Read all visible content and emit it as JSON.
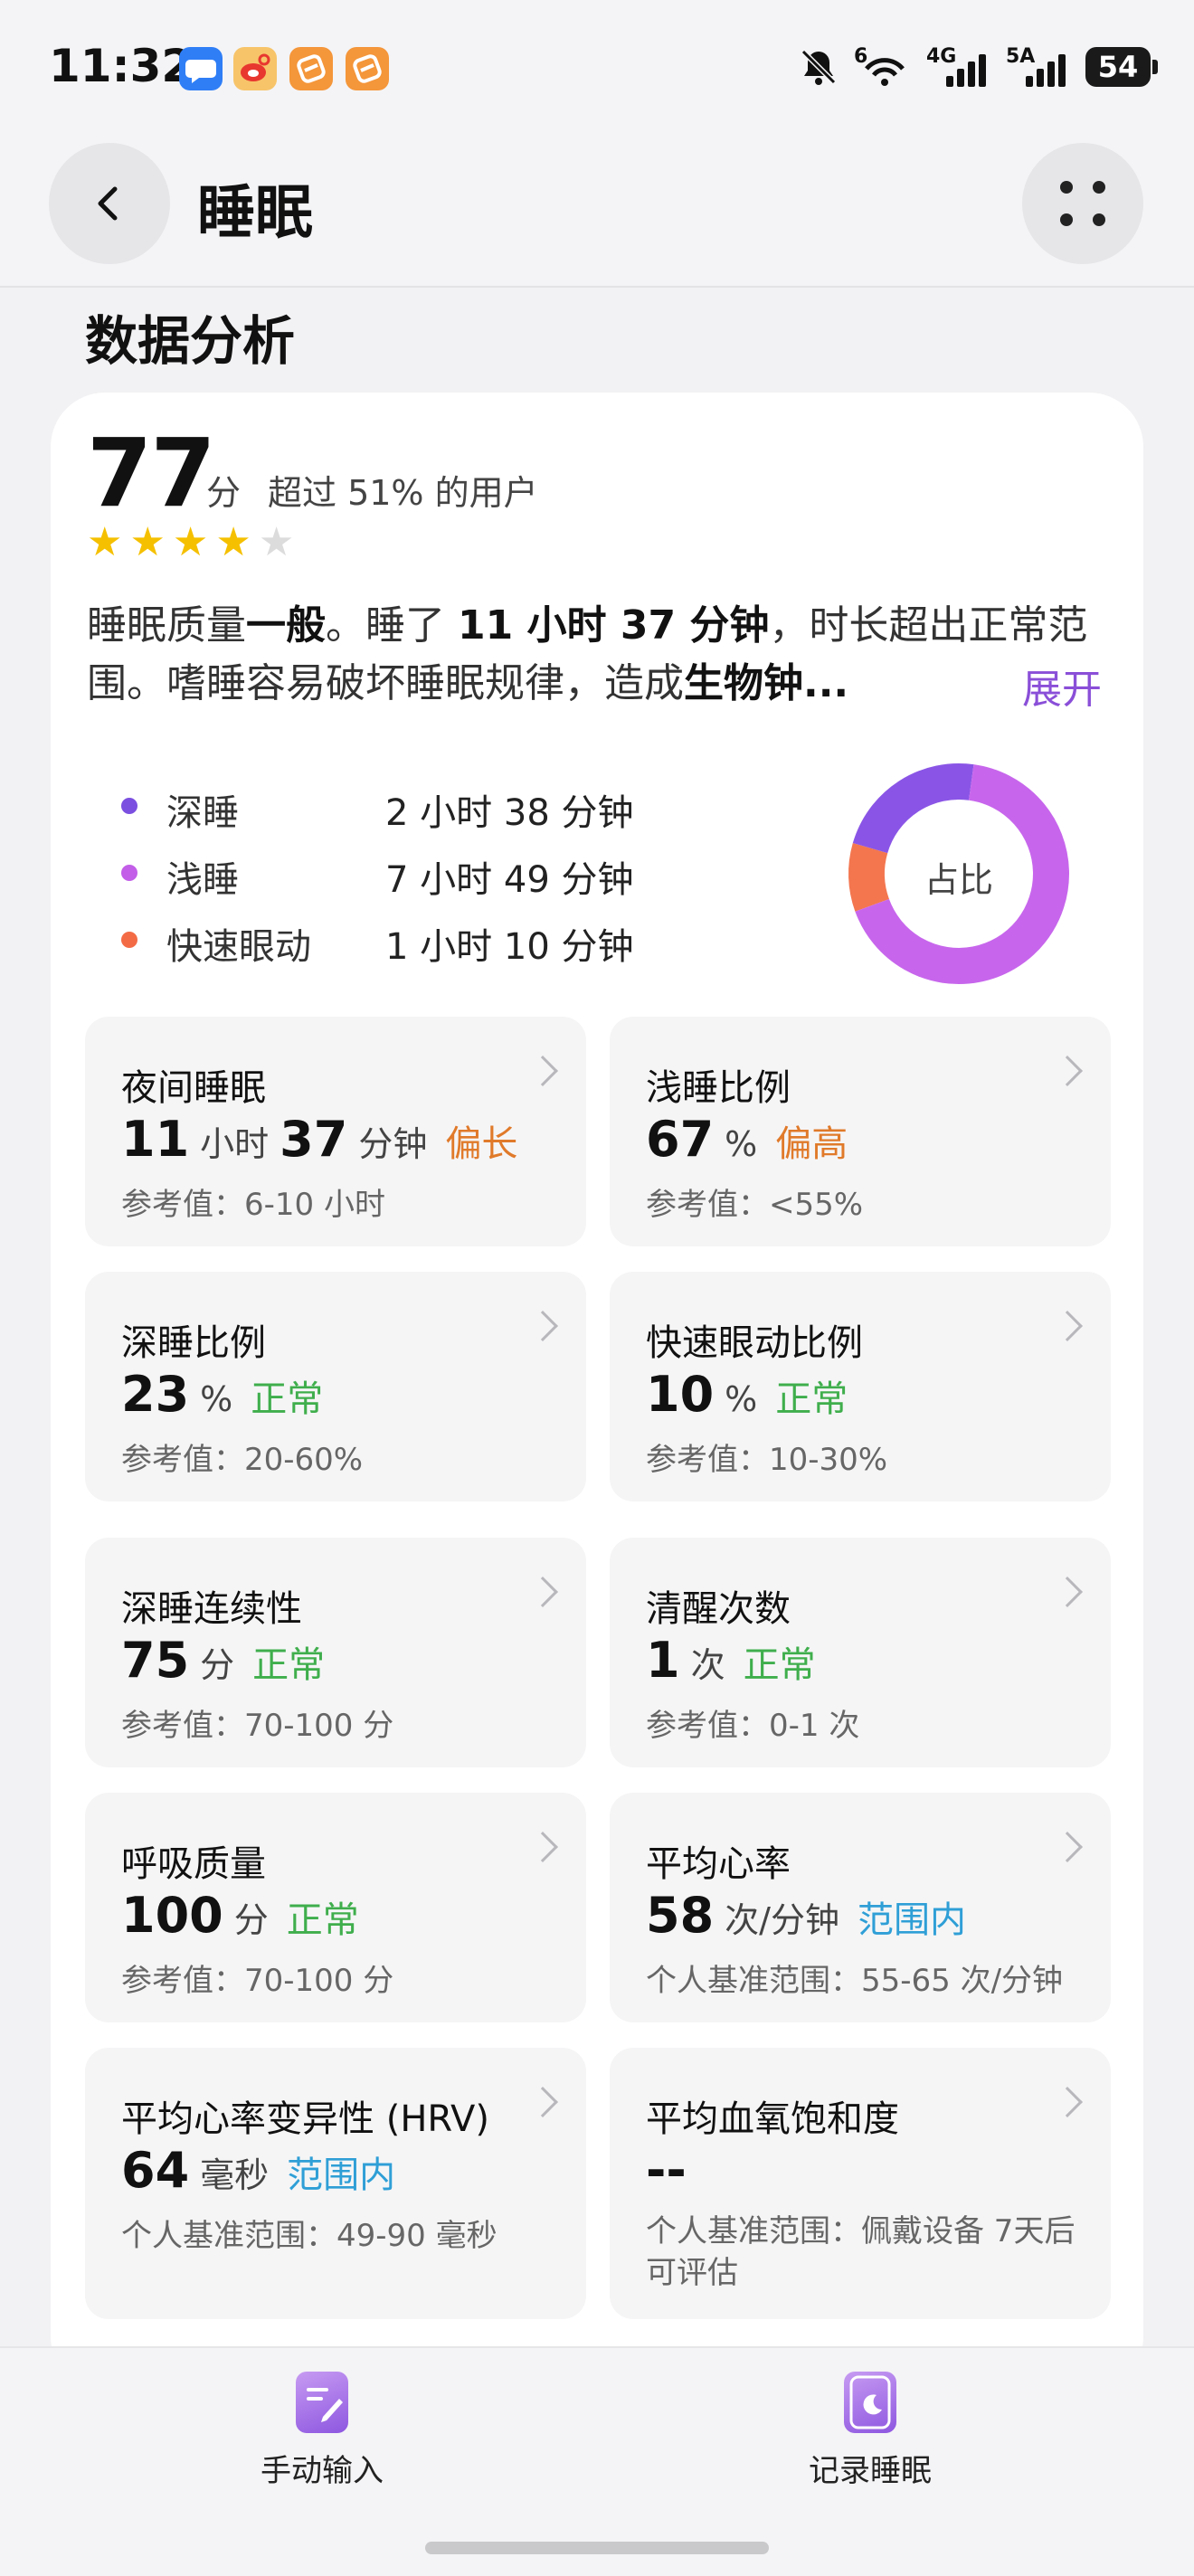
{
  "status_bar": {
    "time": "11:32",
    "signal1_label": "6",
    "signal2_label": "4G",
    "signal3_label": "5A",
    "battery": "54"
  },
  "header": {
    "title": "睡眠"
  },
  "section": {
    "title": "数据分析"
  },
  "score": {
    "value": "77",
    "unit": "分",
    "note": "超过 51% 的用户",
    "stars": 4,
    "max_stars": 5
  },
  "summary": {
    "p1": "睡眠质量",
    "b1": "一般",
    "p2": "。睡了 ",
    "b2": "11 小时 37 分钟",
    "p3": "，时长超出正常范围。嗜睡容易破坏睡眠规律，造成",
    "b3": "生物钟...",
    "expand_label": "展开"
  },
  "legend": [
    {
      "name": "深睡",
      "value": "2 小时 38 分钟",
      "color": "#7b4fe0"
    },
    {
      "name": "浅睡",
      "value": "7 小时 49 分钟",
      "color": "#c25ee8"
    },
    {
      "name": "快速眼动",
      "value": "1 小时 10 分钟",
      "color": "#f36b45"
    }
  ],
  "donut": {
    "label": "占比",
    "segments": [
      {
        "name": "深睡",
        "minutes": 158,
        "color": "#8a55e6"
      },
      {
        "name": "浅睡",
        "minutes": 469,
        "color": "#c766ec"
      },
      {
        "name": "快速眼动",
        "minutes": 70,
        "color": "#f3764f"
      }
    ]
  },
  "metrics": [
    {
      "title": "夜间睡眠",
      "num1": "11",
      "unit1": "小时",
      "num2": "37",
      "unit2": "分钟",
      "status": "偏长",
      "status_color": "#e07a2a",
      "ref": "参考值：6-10 小时"
    },
    {
      "title": "浅睡比例",
      "num1": "67",
      "unit1": "%",
      "status": "偏高",
      "status_color": "#e07a2a",
      "ref": "参考值：<55%"
    },
    {
      "title": "深睡比例",
      "num1": "23",
      "unit1": "%",
      "status": "正常",
      "status_color": "#3fae4c",
      "ref": "参考值：20-60%"
    },
    {
      "title": "快速眼动比例",
      "num1": "10",
      "unit1": "%",
      "status": "正常",
      "status_color": "#3fae4c",
      "ref": "参考值：10-30%"
    },
    {
      "title": "深睡连续性",
      "num1": "75",
      "unit1": "分",
      "status": "正常",
      "status_color": "#3fae4c",
      "ref": "参考值：70-100 分"
    },
    {
      "title": "清醒次数",
      "num1": "1",
      "unit1": "次",
      "status": "正常",
      "status_color": "#3fae4c",
      "ref": "参考值：0-1 次"
    },
    {
      "title": "呼吸质量",
      "num1": "100",
      "unit1": "分",
      "status": "正常",
      "status_color": "#3fae4c",
      "ref": "参考值：70-100 分"
    },
    {
      "title": "平均心率",
      "num1": "58",
      "unit1": "次/分钟",
      "status": "范围内",
      "status_color": "#2f9fd6",
      "ref": "个人基准范围：55-65 次/分钟"
    },
    {
      "title": "平均心率变异性 (HRV)",
      "num1": "64",
      "unit1": "毫秒",
      "status": "范围内",
      "status_color": "#2f9fd6",
      "ref": "个人基准范围：49-90 毫秒"
    },
    {
      "title": "平均血氧饱和度",
      "num1": "--",
      "unit1": "",
      "status": "",
      "status_color": "#2f9fd6",
      "ref": "个人基准范围：佩戴设备 7天后可评估"
    }
  ],
  "bottom_bar": {
    "manual_input": "手动输入",
    "record_sleep": "记录睡眠"
  }
}
